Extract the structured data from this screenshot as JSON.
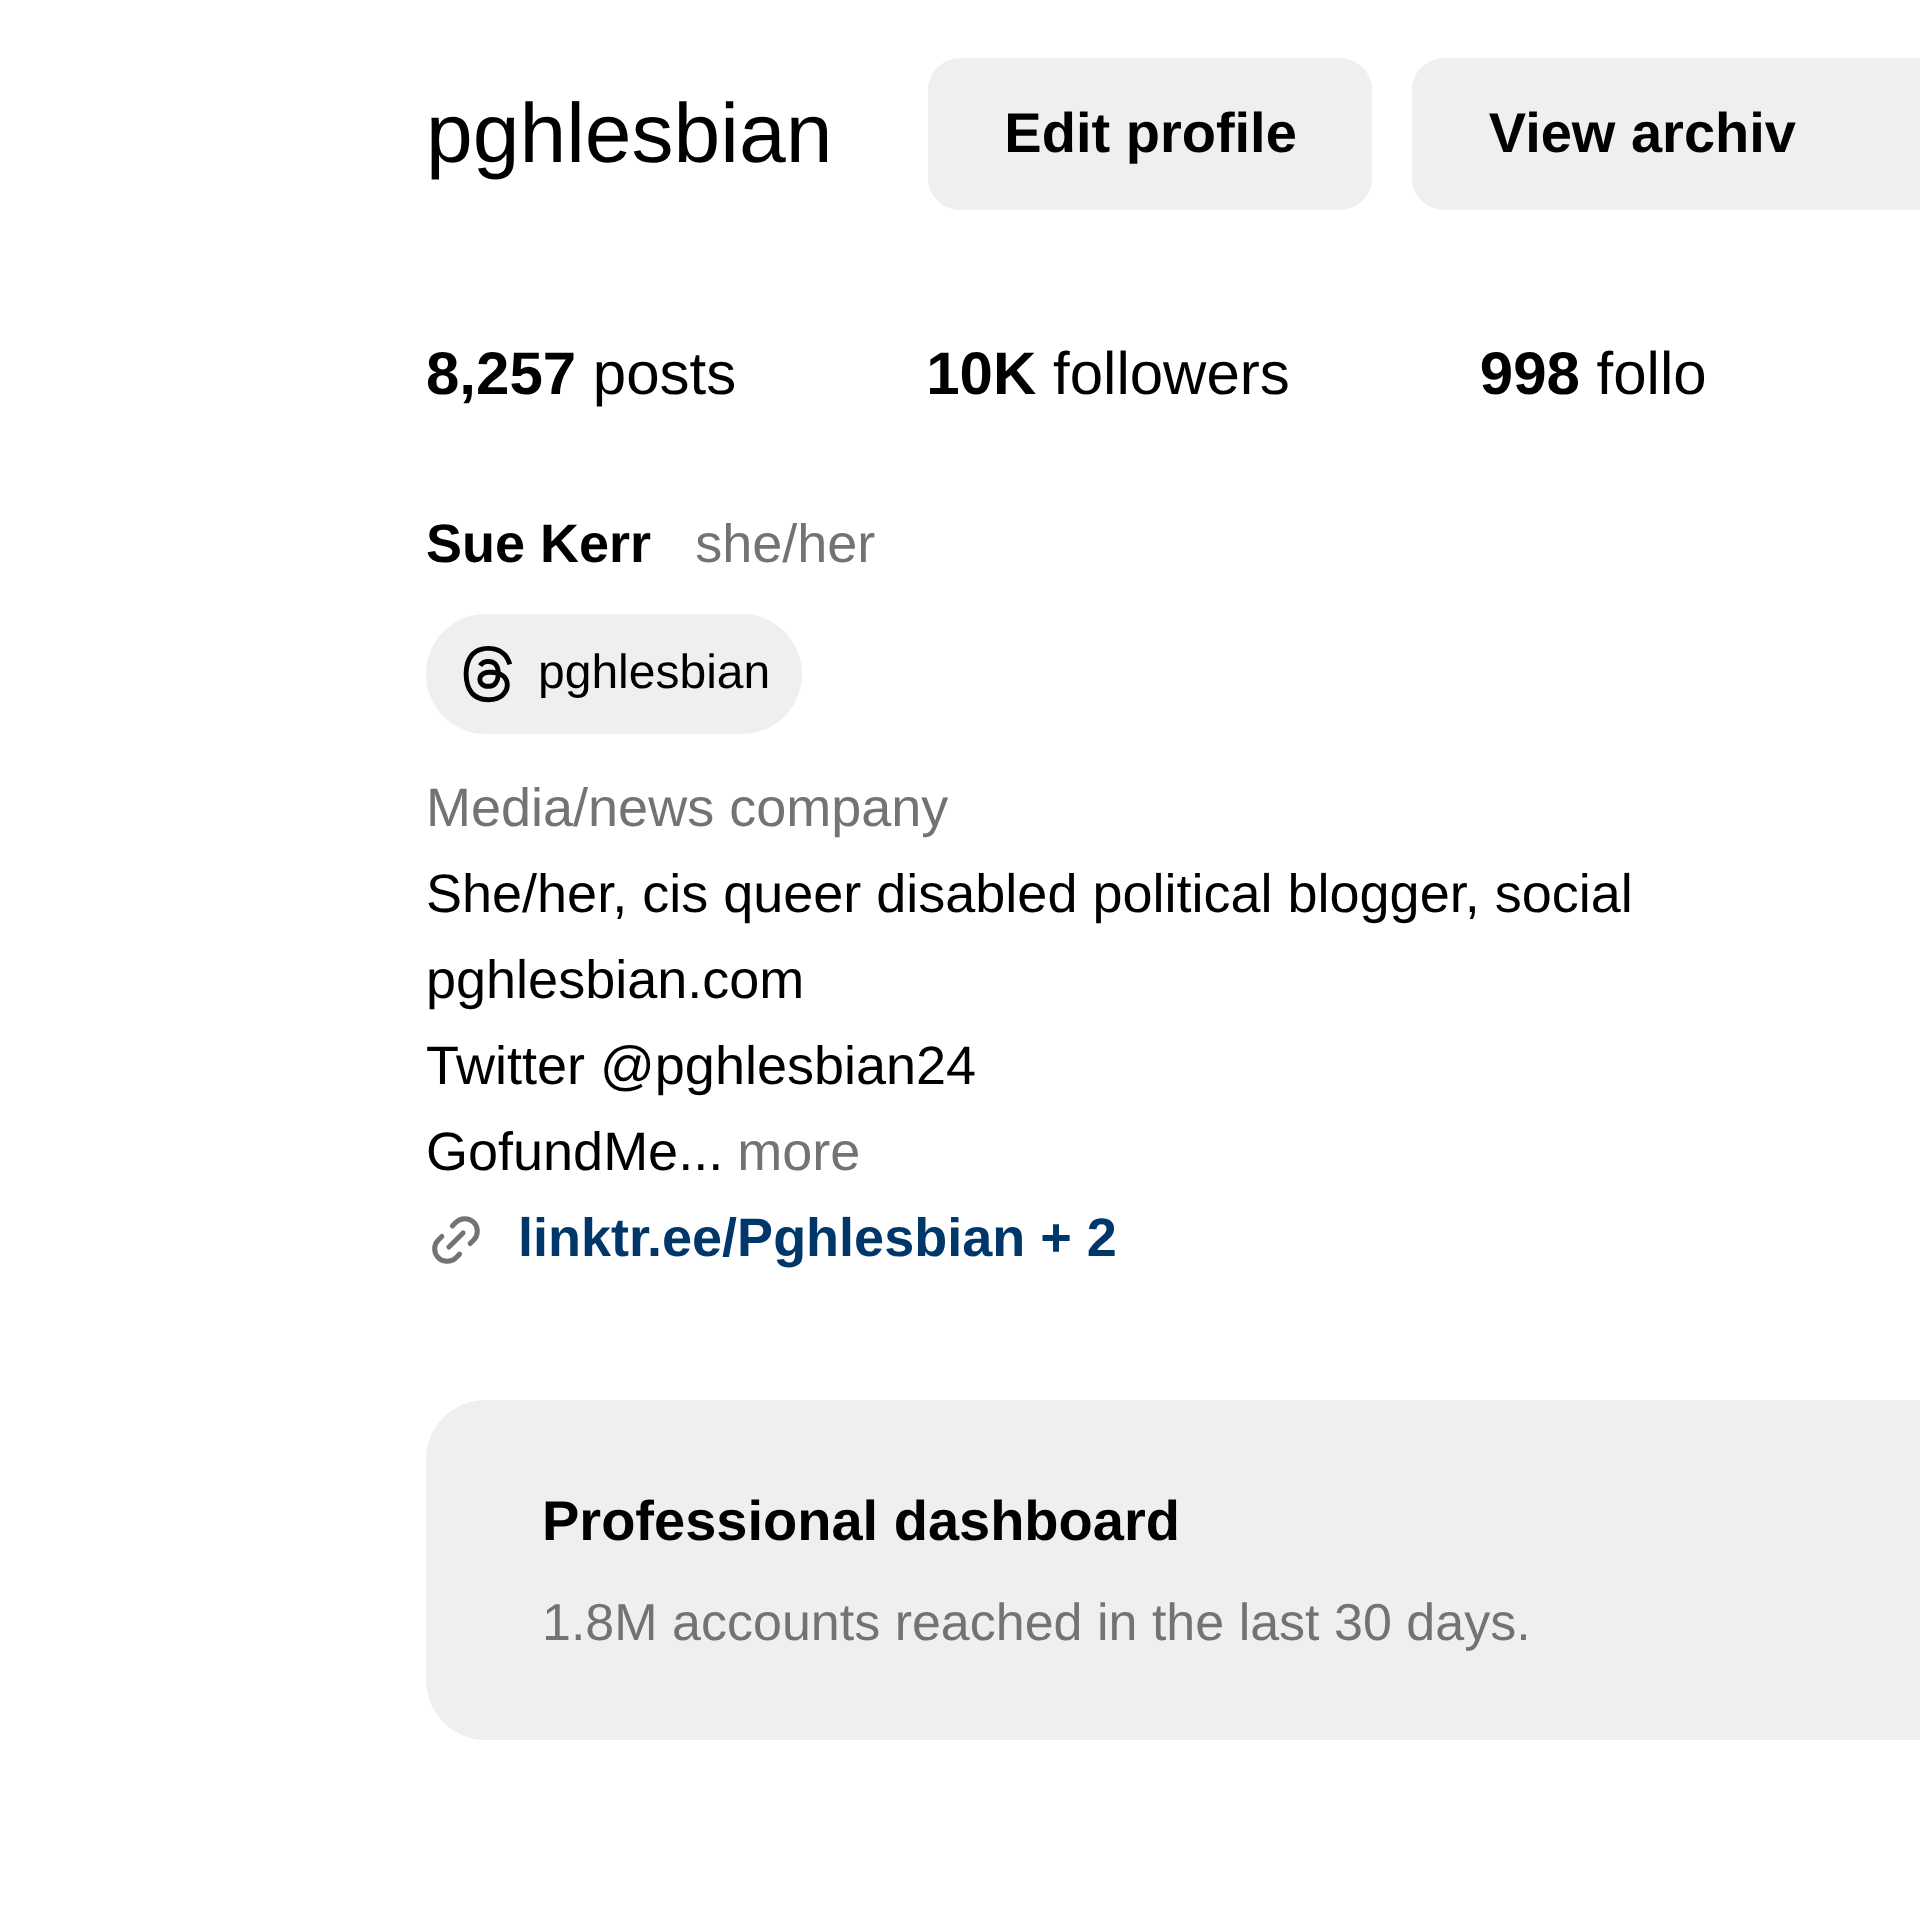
{
  "profile": {
    "username": "pghlesbian",
    "buttons": [
      "Edit profile",
      "View archiv"
    ],
    "stats": [
      "**8,257** posts",
      "**10K** followers",
      "**998** follo"
    ],
    "name": "Sue Kerr",
    "pronouns": "she/her",
    "threads_handle": "pghlesbian",
    "category": "Media/news company",
    "bio_lines": [
      "She/her, cis queer disabled political blogger, social",
      "pghlesbian.com",
      "Twitter @pghlesbian24"
    ],
    "bio_truncated": "GofundMe...",
    "more": "more",
    "link": "linktr.ee/Pghlesbian + 2"
  },
  "dashboard": {
    "title": "Professional dashboard",
    "subtitle": "1.8M accounts reached in the last 30 days."
  }
}
